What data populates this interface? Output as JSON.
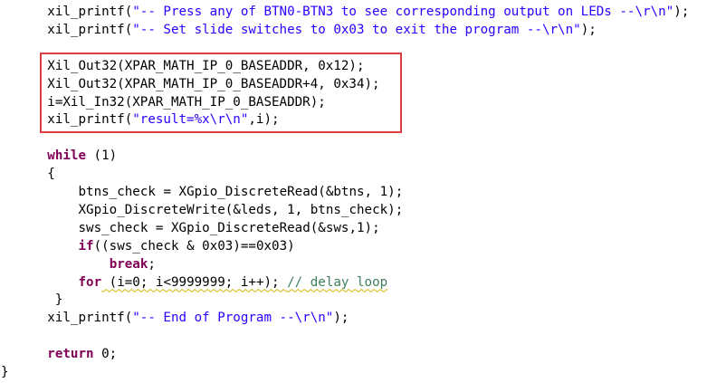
{
  "editor": {
    "lines": [
      {
        "indent": "      ",
        "segments": [
          {
            "t": "xil_printf("
          },
          {
            "t": "\"-- Press any of BTN0-BTN3 to see corresponding output on LEDs --\\r\\n\"",
            "c": "str"
          },
          {
            "t": ");"
          }
        ]
      },
      {
        "indent": "      ",
        "segments": [
          {
            "t": "xil_printf("
          },
          {
            "t": "\"-- Set slide switches to 0x03 to exit the program --\\r\\n\"",
            "c": "str"
          },
          {
            "t": ");"
          }
        ]
      },
      {
        "indent": "",
        "segments": []
      },
      {
        "indent": "      ",
        "segments": [
          {
            "t": "Xil_Out32(XPAR_MATH_IP_0_BASEADDR, 0x12);"
          }
        ]
      },
      {
        "indent": "      ",
        "segments": [
          {
            "t": "Xil_Out32(XPAR_MATH_IP_0_BASEADDR+4, 0x34);"
          }
        ]
      },
      {
        "indent": "      ",
        "segments": [
          {
            "t": "i=Xil_In32(XPAR_MATH_IP_0_BASEADDR);"
          }
        ]
      },
      {
        "indent": "      ",
        "segments": [
          {
            "t": "xil_printf("
          },
          {
            "t": "\"result=%x\\r\\n\"",
            "c": "str"
          },
          {
            "t": ",i);"
          }
        ]
      },
      {
        "indent": "",
        "segments": []
      },
      {
        "indent": "      ",
        "segments": [
          {
            "t": "while",
            "c": "kw"
          },
          {
            "t": " (1)"
          }
        ]
      },
      {
        "indent": "      ",
        "segments": [
          {
            "t": "{"
          }
        ]
      },
      {
        "indent": "          ",
        "segments": [
          {
            "t": "btns_check = XGpio_DiscreteRead(&btns, 1);"
          }
        ]
      },
      {
        "indent": "          ",
        "segments": [
          {
            "t": "XGpio_DiscreteWrite(&leds, 1, btns_check);"
          }
        ]
      },
      {
        "indent": "          ",
        "segments": [
          {
            "t": "sws_check = XGpio_DiscreteRead(&sws,1);"
          }
        ]
      },
      {
        "indent": "          ",
        "segments": [
          {
            "t": "if",
            "c": "kw"
          },
          {
            "t": "((sws_check & 0x03)==0x03)"
          }
        ]
      },
      {
        "indent": "              ",
        "segments": [
          {
            "t": "break",
            "c": "kw"
          },
          {
            "t": ";"
          }
        ]
      },
      {
        "indent": "          ",
        "segments": [
          {
            "t": "for",
            "c": "kw"
          },
          {
            "t": " (i=0; i<9999999; i++); ",
            "sq": true
          },
          {
            "t": "// delay loop",
            "c": "cm",
            "sq": true
          }
        ]
      },
      {
        "indent": "       ",
        "segments": [
          {
            "t": "}"
          }
        ]
      },
      {
        "indent": "      ",
        "segments": [
          {
            "t": "xil_printf("
          },
          {
            "t": "\"-- End of Program --\\r\\n\"",
            "c": "str"
          },
          {
            "t": ");"
          }
        ]
      },
      {
        "indent": "",
        "segments": []
      },
      {
        "indent": "      ",
        "segments": [
          {
            "t": "return",
            "c": "kw"
          },
          {
            "t": " 0;"
          }
        ]
      },
      {
        "indent": "",
        "segments": [
          {
            "t": "}"
          }
        ]
      }
    ]
  }
}
